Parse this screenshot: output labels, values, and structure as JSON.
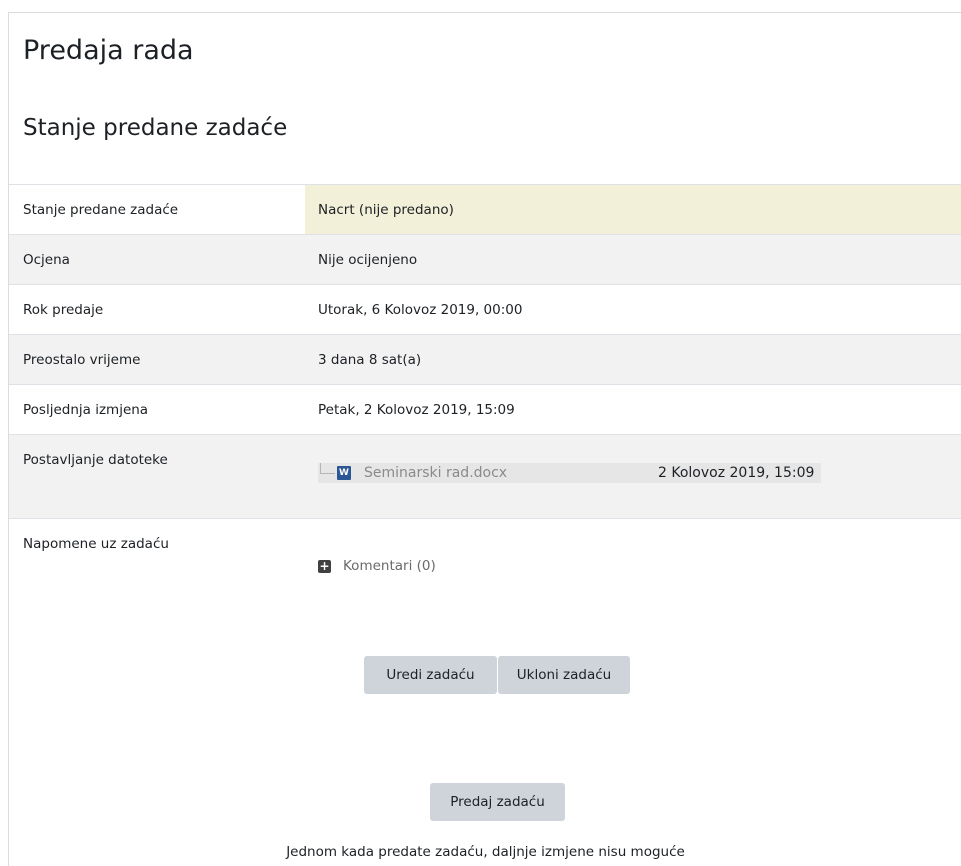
{
  "page_title": "Predaja rada",
  "section_title": "Stanje predane zadaće",
  "status": {
    "submission_status": {
      "label": "Stanje predane zadaće",
      "value": "Nacrt (nije predano)"
    },
    "grade": {
      "label": "Ocjena",
      "value": "Nije ocijenjeno"
    },
    "due_date": {
      "label": "Rok predaje",
      "value": "Utorak, 6 Kolovoz 2019, 00:00"
    },
    "time_remaining": {
      "label": "Preostalo vrijeme",
      "value": "3 dana 8 sat(a)"
    },
    "last_modified": {
      "label": "Posljednja izmjena",
      "value": "Petak, 2 Kolovoz 2019, 15:09"
    },
    "file_submissions": {
      "label": "Postavljanje datoteke",
      "file": {
        "icon": "word-document-icon",
        "name": "Seminarski rad.docx",
        "date": "2 Kolovoz 2019, 15:09"
      }
    },
    "submission_comments": {
      "label": "Napomene uz zadaću",
      "link": "Komentari (0)"
    }
  },
  "actions": {
    "edit_label": "Uredi zadaću",
    "remove_label": "Ukloni zadaću",
    "submit_label": "Predaj zadaću",
    "submit_note": "Jednom kada predate zadaću, daljnje izmjene nisu moguće"
  },
  "colors": {
    "draft_highlight": "#f3f0d9",
    "button_bg": "#ced4da",
    "word_icon": "#2b5797"
  }
}
